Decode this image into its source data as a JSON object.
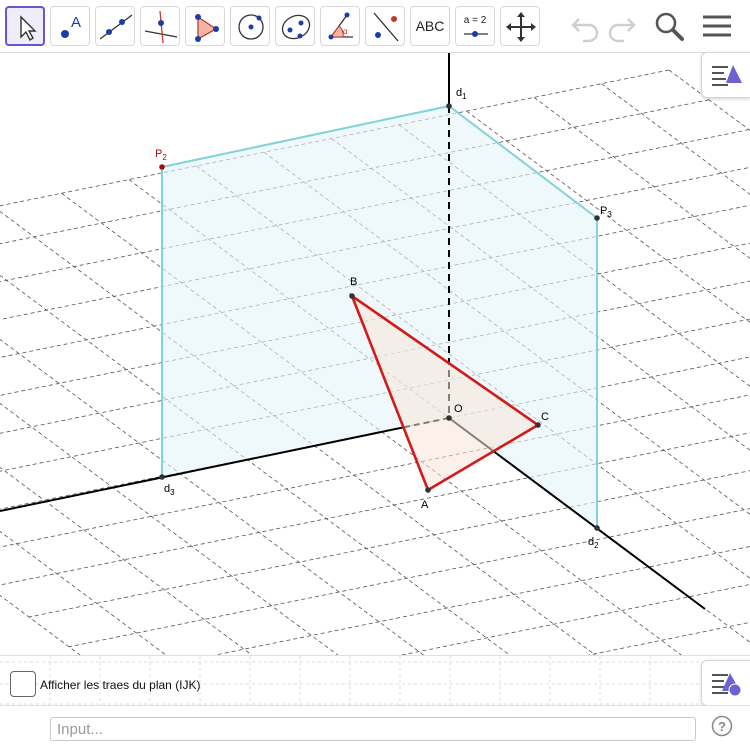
{
  "toolbar": {
    "tools": [
      {
        "name": "move",
        "text": ""
      },
      {
        "name": "point",
        "text": ""
      },
      {
        "name": "line",
        "text": ""
      },
      {
        "name": "perpendicular-line",
        "text": ""
      },
      {
        "name": "polygon",
        "text": ""
      },
      {
        "name": "circle",
        "text": ""
      },
      {
        "name": "ellipse",
        "text": ""
      },
      {
        "name": "angle",
        "text": ""
      },
      {
        "name": "reflect",
        "text": ""
      },
      {
        "name": "text",
        "text": "ABC"
      },
      {
        "name": "slider",
        "text": "a = 2"
      },
      {
        "name": "move-graphics-view",
        "text": ""
      }
    ],
    "point_tool_letter": "A"
  },
  "labels": {
    "d1": "d",
    "d1_sub": "1",
    "d2": "d",
    "d2_sub": "2",
    "d3": "d",
    "d3_sub": "3",
    "P2": "P",
    "P2_sub": "2",
    "P3": "P",
    "P3_sub": "3",
    "A": "A",
    "B": "B",
    "C": "C",
    "O": "O"
  },
  "angle_tool_letter": "α",
  "checkbox": {
    "label": "Afficher les traes du plan (IJK)",
    "checked": false
  },
  "input_bar": {
    "placeholder": "Input..."
  },
  "help_glyph": "?",
  "colors": {
    "accent": "#6557d2",
    "triangle": "#d21a1a",
    "plane_edges": "#7fd3d9",
    "point_red": "#a01010"
  }
}
